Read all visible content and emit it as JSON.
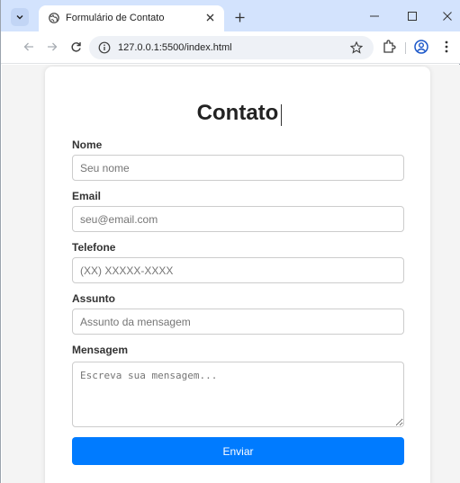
{
  "browser": {
    "tab_title": "Formulário de Contato",
    "url": "127.0.0.1:5500/index.html"
  },
  "form": {
    "title": "Contato",
    "fields": [
      {
        "label": "Nome",
        "placeholder": "Seu nome"
      },
      {
        "label": "Email",
        "placeholder": "seu@email.com"
      },
      {
        "label": "Telefone",
        "placeholder": "(XX) XXXXX-XXXX"
      },
      {
        "label": "Assunto",
        "placeholder": "Assunto da mensagem"
      }
    ],
    "message": {
      "label": "Mensagem",
      "placeholder": "Escreva sua mensagem..."
    },
    "submit_label": "Enviar"
  },
  "colors": {
    "accent": "#007bff",
    "tabstrip": "#d3e3fd",
    "page_background": "#f4f4f4"
  },
  "icons": [
    "tab-search-icon",
    "globe-icon",
    "close-icon",
    "plus-icon",
    "minimize-icon",
    "maximize-icon",
    "window-close-icon",
    "back-arrow-icon",
    "forward-arrow-icon",
    "reload-icon",
    "site-info-icon",
    "star-icon",
    "extensions-icon",
    "profile-icon",
    "more-menu-icon"
  ]
}
